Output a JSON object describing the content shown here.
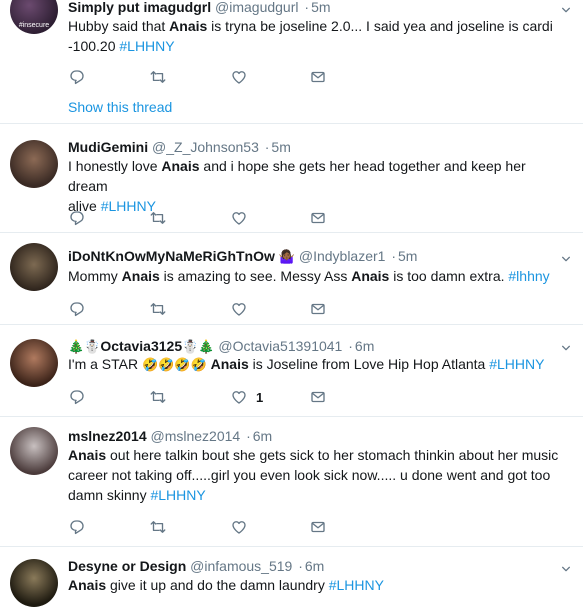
{
  "tweets": [
    {
      "name": "Simply put imagudgrl",
      "handle": "@imagudgurl",
      "time": "5m",
      "pre1": "Hubby said that ",
      "bold1": "Anais",
      "mid1": " is tryna be joseline 2.0... I said yea and joseline is cardi",
      "line2": "-100.20 ",
      "hashtag": "#LHHNY",
      "avatar_text": "#insecure",
      "show_thread": "Show this thread",
      "like_count": ""
    },
    {
      "name": "MudiGemini",
      "handle": "@_Z_Johnson53",
      "time": "5m",
      "pre1": "I honestly love ",
      "bold1": "Anais",
      "mid1": " and i hope she gets her head together and keep her dream",
      "line2": "alive  ",
      "hashtag": "#LHHNY",
      "like_count": ""
    },
    {
      "name": "iDoNtKnOwMyNaMeRiGhTnOw",
      "name_emoji": "🤷🏾‍♀️",
      "handle": "@Indyblazer1",
      "time": "5m",
      "pre1": "Mommy ",
      "bold1": "Anais",
      "mid1": " is amazing to see. Messy Ass ",
      "bold2": "Anais",
      "post1": " is too damn extra.  ",
      "hashtag": "#lhhny",
      "like_count": ""
    },
    {
      "name_prefix_emoji": "🎄☃️",
      "name": "Octavia3125",
      "name_suffix_emoji": "☃️🎄",
      "handle": "@Octavia51391041",
      "time": "6m",
      "pre1": "I'm a STAR ",
      "emoji_run": "🤣🤣🤣🤣",
      "bold1": "Anais",
      "mid1": " is Joseline from Love Hip Hop Atlanta ",
      "hashtag": "#LHHNY",
      "like_count": "1"
    },
    {
      "name": "mslnez2014",
      "handle": "@mslnez2014",
      "time": "6m",
      "bold1": "Anais",
      "mid1": " out here talkin bout she gets sick to her stomach thinkin about her music",
      "line2": "career not taking off.....girl you even look sick now..... u done went and got too",
      "line3": "damn skinny ",
      "hashtag": "#LHHNY",
      "like_count": ""
    },
    {
      "name": "Desyne or Design",
      "handle": "@infamous_519",
      "time": "6m",
      "bold1": "Anais",
      "mid1": " give it up and do the damn laundry ",
      "hashtag": "#LHHNY",
      "like_count": ""
    }
  ],
  "separator": "·",
  "icons": [
    "reply-icon",
    "retweet-icon",
    "like-icon",
    "direct-message-icon",
    "caret-down-icon"
  ],
  "colors": {
    "link": "#1b95e0",
    "secondary": "#657786",
    "text": "#14171a",
    "divider": "#e6ecf0"
  }
}
